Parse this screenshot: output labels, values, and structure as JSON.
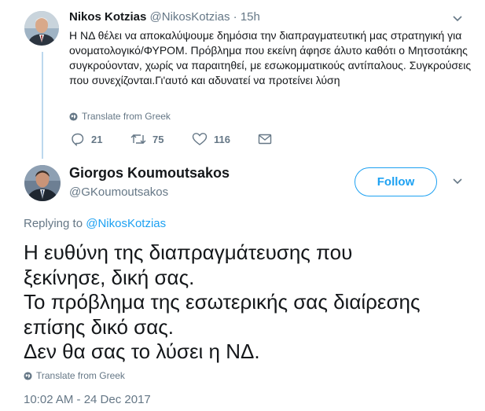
{
  "reply_tweet": {
    "author_name": "Nikos Kotzias",
    "author_handle": "@NikosKotzias",
    "separator": "·",
    "time_ago": "15h",
    "text": "Η ΝΔ θέλει να αποκαλύψουμε δημόσια την διαπραγματευτική μας στρατηγική για ονοματολογικό/ΦΥΡΟΜ. Πρόβλημα που εκείνη άφησε άλυτο καθότι ο Μητσοτάκης συγκρούονταν, χωρίς να παραιτηθεί, με εσωκομματικούς αντίπαλους. Συγκρούσεις που συνεχίζονται.Γι'αυτό και αδυνατεί να προτείνει λύση",
    "translate_label": "Translate from Greek",
    "replies": "21",
    "retweets": "75",
    "likes": "116"
  },
  "main_tweet": {
    "author_name": "Giorgos Koumoutsakos",
    "author_handle": "@GKoumoutsakos",
    "follow_label": "Follow",
    "replying_prefix": "Replying to",
    "replying_handle": "@NikosKotzias",
    "text_lines": [
      "Η ευθύνη της διαπραγμάτευσης που",
      "ξεκίνησε, δική σας.",
      "Το πρόβλημα της εσωτερικής σας διαίρεσης",
      "επίσης δικό σας.",
      "Δεν θα σας το λύσει η ΝΔ."
    ],
    "translate_label": "Translate from Greek",
    "timestamp": "10:02 AM - 24 Dec 2017"
  },
  "colors": {
    "accent": "#1da1f2",
    "muted": "#657786",
    "text": "#14171a",
    "thread_line": "#bcd8ee"
  },
  "icons": [
    "reply-icon",
    "retweet-icon",
    "like-icon",
    "message-icon",
    "globe-icon",
    "chevron-down-icon"
  ]
}
